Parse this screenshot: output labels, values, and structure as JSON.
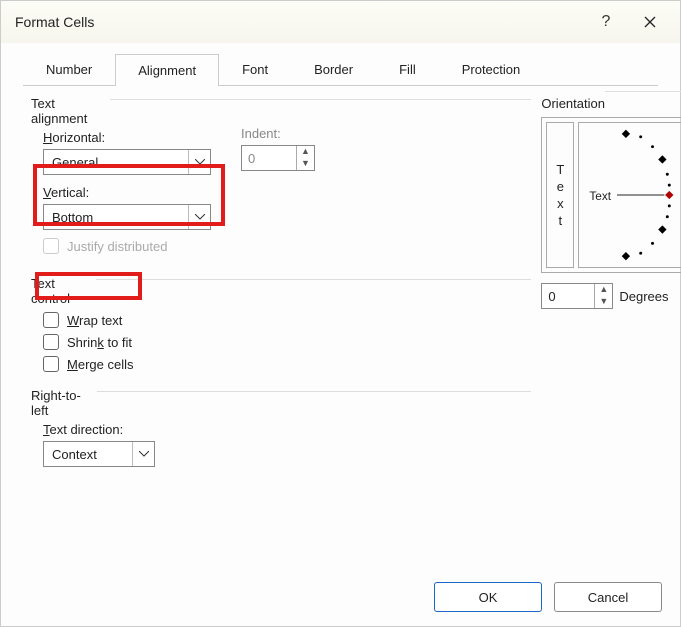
{
  "dialog": {
    "title": "Format Cells"
  },
  "tabs": [
    "Number",
    "Alignment",
    "Font",
    "Border",
    "Fill",
    "Protection"
  ],
  "active_tab": "Alignment",
  "text_alignment": {
    "section": "Text alignment",
    "horizontal_label_pre": "H",
    "horizontal_label_post": "orizontal:",
    "horizontal_value": "General",
    "vertical_label_pre": "V",
    "vertical_label_post": "ertical:",
    "vertical_value": "Bottom",
    "indent_label": "Indent:",
    "indent_value": "0",
    "justify_label": "Justify distributed"
  },
  "text_control": {
    "section": "Text control",
    "wrap_pre": "W",
    "wrap_post": "rap text",
    "shrink_pre": "Shrin",
    "shrink_mid": "k",
    "shrink_post": " to fit",
    "merge_pre": "M",
    "merge_post": "erge cells"
  },
  "rtl": {
    "section": "Right-to-left",
    "dir_label_pre": "T",
    "dir_label_post": "ext direction:",
    "dir_value": "Context"
  },
  "orientation": {
    "section": "Orientation",
    "text_label": "Text",
    "degrees_value": "0",
    "degrees_label_pre": "D",
    "degrees_label_post": "egrees"
  },
  "buttons": {
    "ok": "OK",
    "cancel": "Cancel"
  }
}
